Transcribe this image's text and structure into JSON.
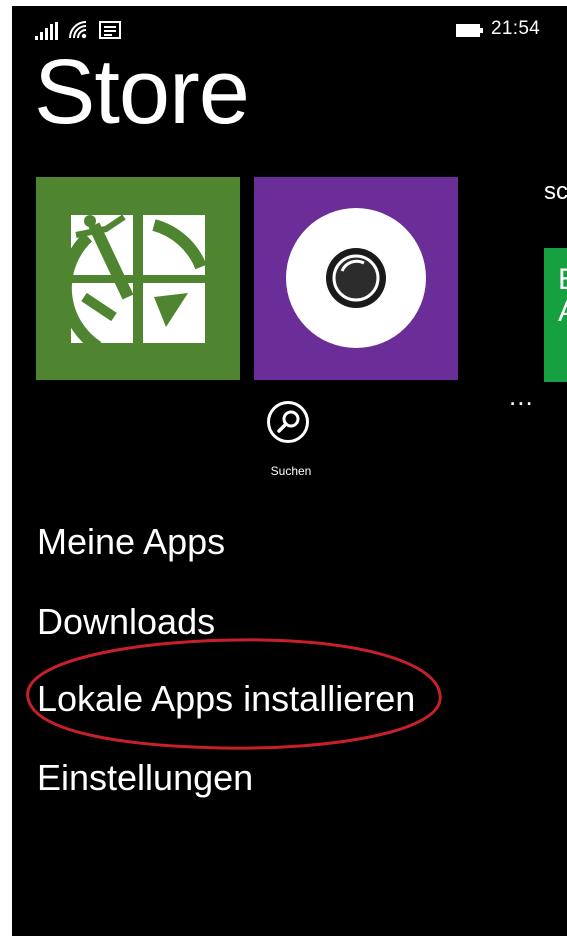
{
  "status_bar": {
    "time": "21:54",
    "icons": [
      "signal-strength-icon",
      "wifi-icon",
      "message-icon",
      "battery-icon"
    ]
  },
  "app": {
    "title": "Store"
  },
  "tiles": [
    {
      "name": "geocaching-app-tile",
      "color": "#4f8530",
      "icon": "geocaching-logo-icon"
    },
    {
      "name": "camera-app-tile",
      "color": "#6b2d98",
      "icon": "camera-lens-icon"
    }
  ],
  "next_section": {
    "heading": "sc",
    "tile_text": "E\nA",
    "tile_color": "#17a03f"
  },
  "more": {
    "label": "..."
  },
  "search": {
    "label": "Suchen",
    "icon": "search-icon"
  },
  "menu": {
    "items": [
      {
        "label": "Meine Apps"
      },
      {
        "label": "Downloads"
      },
      {
        "label": "Lokale Apps installieren"
      },
      {
        "label": "Einstellungen"
      }
    ]
  },
  "annotation": {
    "highlight_color": "#c8202a"
  }
}
